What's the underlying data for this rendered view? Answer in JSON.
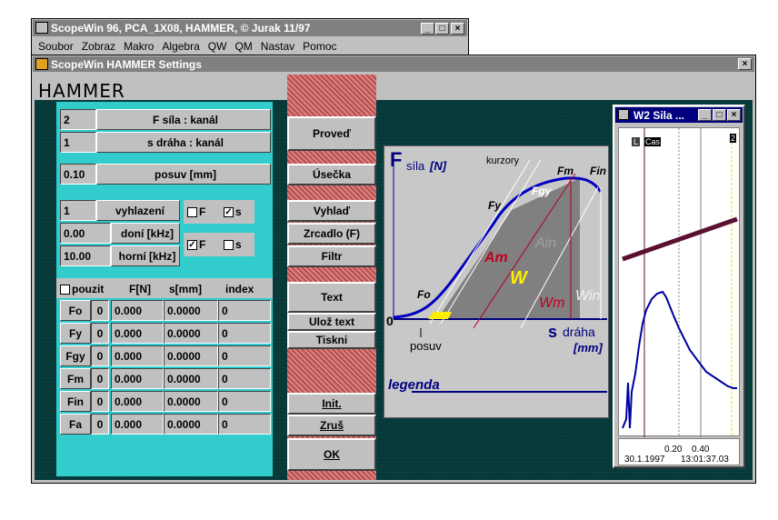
{
  "app_title": "ScopeWin 96, PCA_1X08, HAMMER,  © Jurak 11/97",
  "menu": [
    "Soubor",
    "Zobraz",
    "Makro",
    "Algebra",
    "QW",
    "QM",
    "Nastav",
    "Pomoc"
  ],
  "dialog_title": "ScopeWin HAMMER Settings",
  "heading": "HAMMER",
  "channels": [
    {
      "value": "2",
      "label": "F   síla : kanál"
    },
    {
      "value": "1",
      "label": "s   dráha : kanál"
    }
  ],
  "posuv": {
    "value": "0.10",
    "label": "posuv [mm]"
  },
  "filter": {
    "smooth_value": "1",
    "smooth_label": "vyhlazení",
    "low_value": "0.00",
    "low_label": "doní [kHz]",
    "high_value": "10.00",
    "high_label": "horní [kHz]",
    "cb1_f": "F",
    "cb1_s": "s",
    "cb2_f": "F",
    "cb2_s": "s",
    "cb1_f_checked": false,
    "cb1_s_checked": true,
    "cb2_f_checked": true,
    "cb2_s_checked": false
  },
  "table": {
    "headers": [
      "pouzit",
      "F[N]",
      "s[mm]",
      "index"
    ],
    "rows": [
      {
        "name": "Fo",
        "flag": "0",
        "f": "0.000",
        "s": "0.0000",
        "index": "0"
      },
      {
        "name": "Fy",
        "flag": "0",
        "f": "0.000",
        "s": "0.0000",
        "index": "0"
      },
      {
        "name": "Fgy",
        "flag": "0",
        "f": "0.000",
        "s": "0.0000",
        "index": "0"
      },
      {
        "name": "Fm",
        "flag": "0",
        "f": "0.000",
        "s": "0.0000",
        "index": "0"
      },
      {
        "name": "Fin",
        "flag": "0",
        "f": "0.000",
        "s": "0.0000",
        "index": "0"
      },
      {
        "name": "Fa",
        "flag": "0",
        "f": "0.000",
        "s": "0.0000",
        "index": "0"
      }
    ]
  },
  "buttons": {
    "proved": "Proveď",
    "usecka": "Úsečka",
    "vyhlad": "Vyhlaď",
    "zrcadlo": "Zrcadlo (F)",
    "filtr": "Filtr",
    "text": "Text",
    "uloz": "Ulož text",
    "tiskni": "Tiskni",
    "init": "Init.",
    "zrus": "Zruš",
    "ok": "OK"
  },
  "diagram": {
    "f_label": "F",
    "sila": "síla",
    "sila_unit": "[N]",
    "kurzory": "kurzory",
    "fm": "Fm",
    "fin": "Fin",
    "fy": "Fy",
    "fgy": "Fgy",
    "ain": "Ain",
    "am": "Am",
    "w": "W",
    "wm": "Wm",
    "win": "Win",
    "fo": "Fo",
    "zero": "0",
    "posuv": "posuv",
    "s_label": "s",
    "draha": "dráha",
    "draha_unit": "[mm]",
    "legenda": "legenda"
  },
  "w2": {
    "title": "W2 Sila ...",
    "l": "L",
    "cas": "Cas",
    "num": "2",
    "tick1": "0.20",
    "tick2": "0.40",
    "date": "30.1.1997",
    "time": "13:01:37.03"
  },
  "colors": {
    "teal": "#33cccc",
    "navy": "#000080",
    "dialog_bg": "#003a3a",
    "trace": "#0000a0",
    "bar": "#5a1030"
  }
}
